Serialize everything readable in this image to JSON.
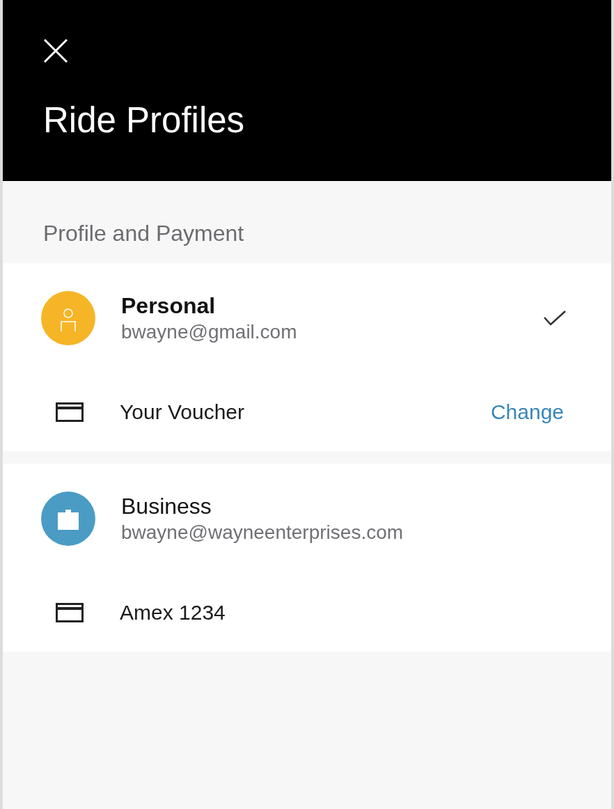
{
  "header": {
    "title": "Ride Profiles"
  },
  "section": {
    "title": "Profile and Payment"
  },
  "profiles": [
    {
      "kind": "personal",
      "name": "Personal",
      "email": "bwayne@gmail.com",
      "color": "#f6b526",
      "selected": true,
      "payment": {
        "label": "Your Voucher",
        "action": "Change"
      }
    },
    {
      "kind": "business",
      "name": "Business",
      "email": "bwayne@wayneenterprises.com",
      "color": "#4a9cc4",
      "selected": false,
      "payment": {
        "label": "Amex 1234"
      }
    }
  ]
}
